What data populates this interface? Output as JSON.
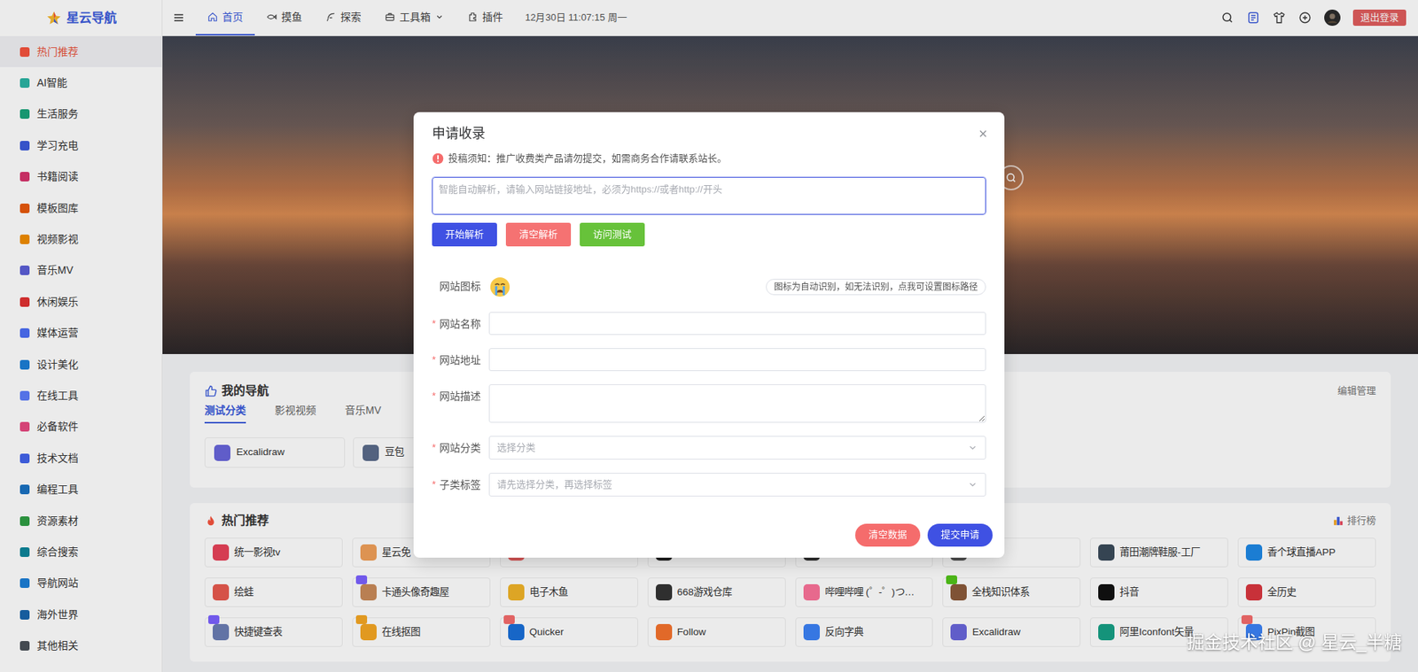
{
  "logo": {
    "text": "星云导航"
  },
  "sidebar": {
    "items": [
      {
        "label": "热门推荐",
        "selected": true,
        "color": "#f5533d"
      },
      {
        "label": "AI智能",
        "selected": false,
        "color": "#2bb3a3"
      },
      {
        "label": "生活服务",
        "selected": false,
        "color": "#1aa37a"
      },
      {
        "label": "学习充电",
        "selected": false,
        "color": "#3b5bdb"
      },
      {
        "label": "书籍阅读",
        "selected": false,
        "color": "#d6336c"
      },
      {
        "label": "模板图库",
        "selected": false,
        "color": "#e8590c"
      },
      {
        "label": "视频影视",
        "selected": false,
        "color": "#f08c00"
      },
      {
        "label": "音乐MV",
        "selected": false,
        "color": "#5c5fd6"
      },
      {
        "label": "休闲娱乐",
        "selected": false,
        "color": "#e03131"
      },
      {
        "label": "媒体运营",
        "selected": false,
        "color": "#4c6ef5"
      },
      {
        "label": "设计美化",
        "selected": false,
        "color": "#1c7ed6"
      },
      {
        "label": "在线工具",
        "selected": false,
        "color": "#5c7cfa"
      },
      {
        "label": "必备软件",
        "selected": false,
        "color": "#e64980"
      },
      {
        "label": "技术文档",
        "selected": false,
        "color": "#4263eb"
      },
      {
        "label": "编程工具",
        "selected": false,
        "color": "#1971c2"
      },
      {
        "label": "资源素材",
        "selected": false,
        "color": "#2f9e44"
      },
      {
        "label": "综合搜索",
        "selected": false,
        "color": "#0c8599"
      },
      {
        "label": "导航网站",
        "selected": false,
        "color": "#1c7ed6"
      },
      {
        "label": "海外世界",
        "selected": false,
        "color": "#1864ab"
      },
      {
        "label": "其他相关",
        "selected": false,
        "color": "#495057"
      }
    ]
  },
  "header": {
    "tabs": [
      {
        "label": "首页",
        "selected": true,
        "has_menu": false
      },
      {
        "label": "摸鱼",
        "selected": false,
        "has_menu": false
      },
      {
        "label": "探索",
        "selected": false,
        "has_menu": false
      },
      {
        "label": "工具箱",
        "selected": false,
        "has_menu": true
      },
      {
        "label": "插件",
        "selected": false,
        "has_menu": false
      }
    ],
    "datetime": "12月30日 11:07:15 周一",
    "logout": "退出登录"
  },
  "my_nav": {
    "title": "我的导航",
    "manage": "编辑管理",
    "tabs": [
      {
        "label": "测试分类",
        "selected": true
      },
      {
        "label": "影视视频",
        "selected": false
      },
      {
        "label": "音乐MV",
        "selected": false
      }
    ],
    "items": [
      {
        "name": "Excalidraw",
        "color": "#6965db"
      },
      {
        "name": "豆包",
        "color": "#5b6b8a"
      }
    ]
  },
  "hot": {
    "title": "热门推荐",
    "ranking": "排行榜",
    "items": [
      {
        "name": "统一影视tv",
        "color": "#e8435a",
        "badge": null
      },
      {
        "name": "星云免",
        "color": "#f0a05a",
        "badge": null
      },
      {
        "name": "",
        "color": "#e85d5d",
        "badge": null
      },
      {
        "name": "",
        "color": "#222222",
        "badge": null
      },
      {
        "name": "",
        "color": "#333333",
        "badge": null
      },
      {
        "name": "",
        "color": "#555555",
        "badge": null
      },
      {
        "name": "莆田潮牌鞋服-工厂",
        "color": "#3a4a5a",
        "badge": null
      },
      {
        "name": "香个球直播APP",
        "color": "#1e88e5",
        "badge": null
      },
      {
        "name": "绘蛙",
        "color": "#e85a4f",
        "badge": null
      },
      {
        "name": "卡通头像奇趣屋",
        "color": "#c98a5a",
        "badge": "#7b61ff"
      },
      {
        "name": "电子木鱼",
        "color": "#f0b429",
        "badge": null
      },
      {
        "name": "668游戏仓库",
        "color": "#333333",
        "badge": null
      },
      {
        "name": "哔哩哔哩 (゜-゜)つ…",
        "color": "#fb7299",
        "badge": null
      },
      {
        "name": "全栈知识体系",
        "color": "#8a5a3a",
        "badge": "#52c41a"
      },
      {
        "name": "抖音",
        "color": "#111111",
        "badge": null
      },
      {
        "name": "全历史",
        "color": "#d9363e",
        "badge": null
      },
      {
        "name": "快捷键查表",
        "color": "#6b7db3",
        "badge": "#7b61ff"
      },
      {
        "name": "在线抠图",
        "color": "#f5a623",
        "badge": "#f5a623"
      },
      {
        "name": "Quicker",
        "color": "#1a6fd8",
        "badge": "#f56c6c"
      },
      {
        "name": "Follow",
        "color": "#f5722d",
        "badge": null
      },
      {
        "name": "反向字典",
        "color": "#3b82f6",
        "badge": null
      },
      {
        "name": "Excalidraw",
        "color": "#6965db",
        "badge": null
      },
      {
        "name": "阿里Iconfont矢量…",
        "color": "#16a085",
        "badge": null
      },
      {
        "name": "PixPin截图",
        "color": "#3b82f6",
        "badge": "#f56c6c"
      }
    ]
  },
  "dialog": {
    "title": "申请收录",
    "close": "×",
    "notice": "投稿须知：推广收费类产品请勿提交，如需商务合作请联系站长。",
    "url_input": {
      "placeholder": "智能自动解析，请输入网站链接地址，必须为https://或者http://开头",
      "focused": true
    },
    "actions": [
      {
        "label": "开始解析",
        "color": "#3f51e3"
      },
      {
        "label": "清空解析",
        "color": "#f57272"
      },
      {
        "label": "访问测试",
        "color": "#67c23a"
      }
    ],
    "icon_field": {
      "label": "网站图标",
      "hint": "图标为自动识别，如无法识别，点我可设置图标路径"
    },
    "required_mark": "*",
    "fields": [
      {
        "label": "网站名称",
        "required": true,
        "kind": "input",
        "placeholder": ""
      },
      {
        "label": "网站地址",
        "required": true,
        "kind": "input",
        "placeholder": ""
      },
      {
        "label": "网站描述",
        "required": true,
        "kind": "textarea",
        "placeholder": ""
      },
      {
        "label": "网站分类",
        "required": true,
        "kind": "select",
        "placeholder": "选择分类"
      },
      {
        "label": "子类标签",
        "required": true,
        "kind": "select",
        "placeholder": "请先选择分类，再选择标签"
      }
    ],
    "footer": [
      {
        "label": "清空数据",
        "color": "#f56c6c"
      },
      {
        "label": "提交申请",
        "color": "#3f51e3"
      }
    ]
  },
  "watermark": "掘金技术社区 @ 星云_半糖"
}
